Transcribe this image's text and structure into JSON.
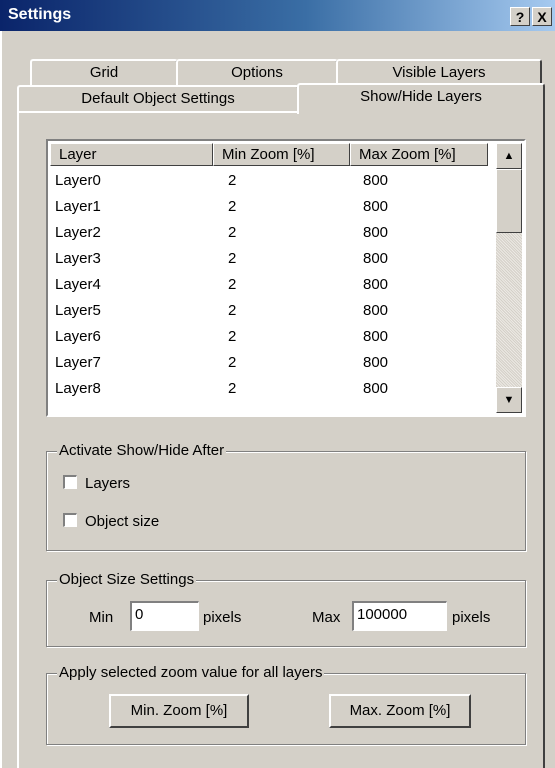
{
  "window": {
    "title": "Settings",
    "help_label": "?",
    "close_label": "X"
  },
  "tabs": {
    "row_back": [
      "Grid",
      "Options",
      "Visible Layers"
    ],
    "row_front": [
      "Default Object Settings",
      "Show/Hide Layers"
    ],
    "active": "Show/Hide Layers"
  },
  "layer_list": {
    "columns": [
      "Layer",
      "Min Zoom [%]",
      "Max Zoom [%]"
    ],
    "rows": [
      [
        "Layer0",
        "2",
        "800"
      ],
      [
        "Layer1",
        "2",
        "800"
      ],
      [
        "Layer2",
        "2",
        "800"
      ],
      [
        "Layer3",
        "2",
        "800"
      ],
      [
        "Layer4",
        "2",
        "800"
      ],
      [
        "Layer5",
        "2",
        "800"
      ],
      [
        "Layer6",
        "2",
        "800"
      ],
      [
        "Layer7",
        "2",
        "800"
      ],
      [
        "Layer8",
        "2",
        "800"
      ]
    ]
  },
  "activate_group": {
    "legend": "Activate Show/Hide After",
    "layers_label": "Layers",
    "layers_checked": false,
    "object_size_label": "Object size",
    "object_size_checked": false
  },
  "object_size_group": {
    "legend": "Object Size Settings",
    "min_label": "Min",
    "min_value": "0",
    "min_unit": "pixels",
    "max_label": "Max",
    "max_value": "100000",
    "max_unit": "pixels"
  },
  "apply_group": {
    "legend": "Apply selected zoom value for all layers",
    "min_button": "Min. Zoom [%]",
    "max_button": "Max. Zoom [%]"
  }
}
